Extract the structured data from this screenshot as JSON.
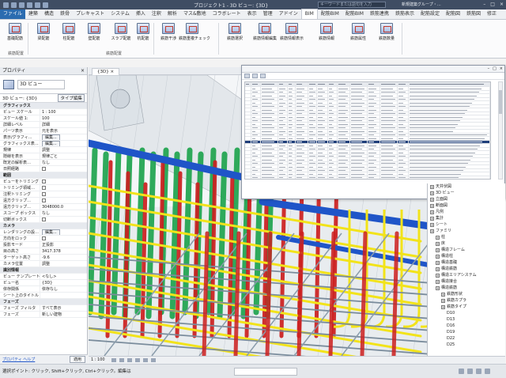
{
  "titlebar": {
    "title": "プロジェクト1 - 3D ビュー: {3D}",
    "search_placeholder": "キーワードまたは語句を入力",
    "user": "新規建築グループ・…",
    "window_buttons": [
      "–",
      "□",
      "×"
    ]
  },
  "ribbon": {
    "tabs": [
      "ファイル",
      "建築",
      "構造",
      "鉄骨",
      "プレキャスト",
      "システム",
      "挿入",
      "注釈",
      "解析",
      "マス&敷地",
      "コラボレート",
      "表示",
      "管理",
      "アドイン",
      "BIM",
      "配筋BIM",
      "配筋BIM",
      "鉄筋連携",
      "鉄筋表示",
      "配筋設定",
      "配筋図",
      "鉄筋図",
      "修正"
    ],
    "active_tab_index": 14,
    "buttons": [
      "基礎配筋",
      "梁配筋",
      "柱配筋",
      "壁配筋",
      "スラブ配筋",
      "杭配筋",
      "鉄筋干渉",
      "鉄筋重複チェック",
      "鉄筋選択",
      "鉄筋情報編集",
      "鉄筋情報表示",
      "鉄筋情報",
      "鉄筋属性",
      "鉄筋数量"
    ],
    "groups": [
      "鉄筋配置",
      "鉄筋配置"
    ]
  },
  "properties": {
    "title": "プロパティ",
    "type_name": "3D ビュー",
    "selector_label": "3D ビュー: {3D}",
    "edit_type_label": "タイプ編集",
    "rows": [
      {
        "k": "グラフィックス",
        "cat": true
      },
      {
        "k": "ビュー スケール",
        "v": "1 : 100"
      },
      {
        "k": "スケール値 1:",
        "v": "100"
      },
      {
        "k": "詳細レベル",
        "v": "詳細"
      },
      {
        "k": "パーツ表示",
        "v": "元を表示"
      },
      {
        "k": "表示/グラフィ…",
        "v": "編集..."
      },
      {
        "k": "グラフィックス表…",
        "v": "編集..."
      },
      {
        "k": "規律",
        "v": "調整"
      },
      {
        "k": "隠線を表示",
        "v": "規律ごと"
      },
      {
        "k": "既定の解析表…",
        "v": "なし"
      },
      {
        "k": "日照経路",
        "check": true
      },
      {
        "k": "範囲",
        "cat": true
      },
      {
        "k": "ビューをトリミング",
        "check": true
      },
      {
        "k": "トリミング領域…",
        "check": true
      },
      {
        "k": "注釈トリミング",
        "check": true
      },
      {
        "k": "遠方クリップ…",
        "check": true
      },
      {
        "k": "遠方クリップ…",
        "v": "3048000.0"
      },
      {
        "k": "スコープ ボックス",
        "v": "なし"
      },
      {
        "k": "切断ボックス",
        "check": true
      },
      {
        "k": "カメラ",
        "cat": true
      },
      {
        "k": "レンダリングの設…",
        "v": "編集..."
      },
      {
        "k": "方向をロック",
        "check": true
      },
      {
        "k": "投影モード",
        "v": "正投影"
      },
      {
        "k": "目の高さ",
        "v": "3417.378"
      },
      {
        "k": "ターゲット高さ",
        "v": "-9.6"
      },
      {
        "k": "カメラ位置",
        "v": "調整"
      },
      {
        "k": "識別情報",
        "cat": true
      },
      {
        "k": "ビュー テンプレート",
        "v": "<なし>"
      },
      {
        "k": "ビュー名",
        "v": "{3D}"
      },
      {
        "k": "依存関係",
        "v": "依存なし"
      },
      {
        "k": "シート上のタイトル",
        "v": ""
      },
      {
        "k": "フェーズ",
        "cat": true
      },
      {
        "k": "フェーズ フィルタ",
        "v": "すべて表示"
      },
      {
        "k": "フェーズ",
        "v": "新しい建物"
      }
    ],
    "help_link": "プロパティ ヘルプ",
    "apply_label": "適用"
  },
  "view_tab": {
    "label": "{3D}"
  },
  "view_control": {
    "scale": "1 : 100"
  },
  "browser": {
    "items": [
      {
        "label": "天井伏図",
        "indent": 0
      },
      {
        "label": "3D ビュー",
        "indent": 0
      },
      {
        "label": "立面図",
        "indent": 0
      },
      {
        "label": "断面図",
        "indent": 0
      },
      {
        "label": "凡例",
        "indent": 0
      },
      {
        "label": "集計",
        "indent": 0
      },
      {
        "label": "シート",
        "indent": 0
      },
      {
        "label": "ファミリ",
        "indent": 0
      },
      {
        "label": "柱",
        "indent": 1
      },
      {
        "label": "床",
        "indent": 1
      },
      {
        "label": "構造フレーム",
        "indent": 1
      },
      {
        "label": "構造柱",
        "indent": 1
      },
      {
        "label": "構造基礎",
        "indent": 1
      },
      {
        "label": "構造鉄筋",
        "indent": 1
      },
      {
        "label": "構造エリアシステム",
        "indent": 1
      },
      {
        "label": "構造接合",
        "indent": 1
      },
      {
        "label": "構造鉄筋",
        "indent": 1
      },
      {
        "label": "鉄筋形状",
        "indent": 2
      },
      {
        "label": "鉄筋カプラ",
        "indent": 2
      },
      {
        "label": "鉄筋タイプ",
        "indent": 2
      },
      {
        "label": "D10",
        "indent": 3
      },
      {
        "label": "D13",
        "indent": 3
      },
      {
        "label": "D16",
        "indent": 3
      },
      {
        "label": "D19",
        "indent": 3
      },
      {
        "label": "D22",
        "indent": 3
      },
      {
        "label": "D25",
        "indent": 3
      }
    ]
  },
  "status": {
    "text": "選択ポイント: クリック, Shift+クリック, Ctrl+クリック。編集は"
  },
  "colors": {
    "titlebar": "#3f4d63",
    "file_tab": "#2b6cb0",
    "selected_row": "#1f3f7a",
    "rebar_yellow": "#f2e31a",
    "rebar_red": "#cc1f1f",
    "rebar_green": "#1aa24a",
    "rebar_blue": "#1f55c8"
  }
}
